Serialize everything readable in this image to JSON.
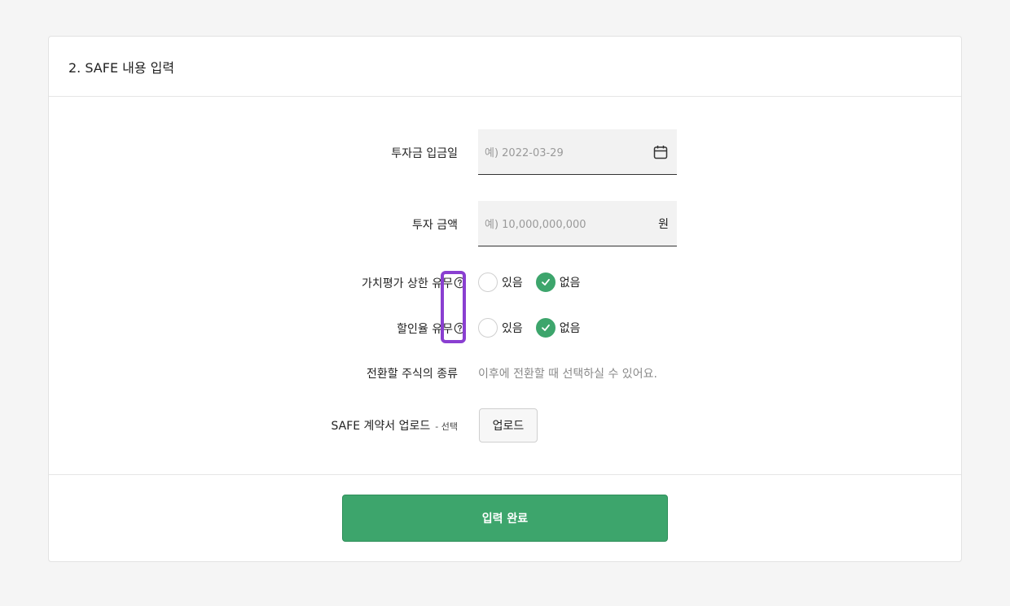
{
  "section": {
    "title": "2. SAFE 내용 입력"
  },
  "fields": {
    "deposit_date": {
      "label": "투자금 입금일",
      "placeholder": "예) 2022-03-29"
    },
    "amount": {
      "label": "투자 금액",
      "placeholder": "예) 10,000,000,000",
      "unit": "원"
    },
    "valuation_cap": {
      "label": "가치평가 상한 유무",
      "options": [
        "있음",
        "없음"
      ],
      "selected": "없음"
    },
    "discount": {
      "label": "할인율 유무",
      "options": [
        "있음",
        "없음"
      ],
      "selected": "없음"
    },
    "stock_type": {
      "label": "전환할 주식의 종류",
      "note": "이후에 전환할 때 선택하실 수 있어요."
    },
    "upload": {
      "label": "SAFE 계약서 업로드",
      "hint": "- 선택",
      "button": "업로드"
    }
  },
  "submit": {
    "label": "입력 완료"
  },
  "colors": {
    "accent": "#3da56c",
    "highlight": "#8a3fd1"
  }
}
